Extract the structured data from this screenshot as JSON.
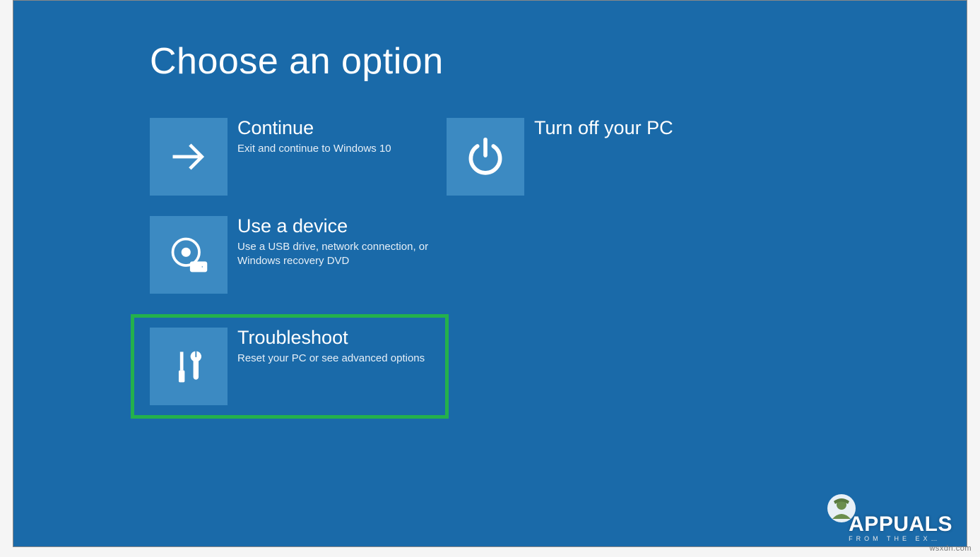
{
  "title": "Choose an option",
  "options": {
    "continue": {
      "title": "Continue",
      "desc": "Exit and continue to Windows 10"
    },
    "useDevice": {
      "title": "Use a device",
      "desc": "Use a USB drive, network connection, or Windows recovery DVD"
    },
    "troubleshoot": {
      "title": "Troubleshoot",
      "desc": "Reset your PC or see advanced options"
    },
    "turnOff": {
      "title": "Turn off your PC",
      "desc": ""
    }
  },
  "branding": {
    "main": "APPUALS",
    "sub": "FROM THE EX…"
  },
  "watermark": "wsxdn.com",
  "colors": {
    "background": "#1a6aa9",
    "tile": "#3c8ac2",
    "highlight": "#24b14c"
  }
}
